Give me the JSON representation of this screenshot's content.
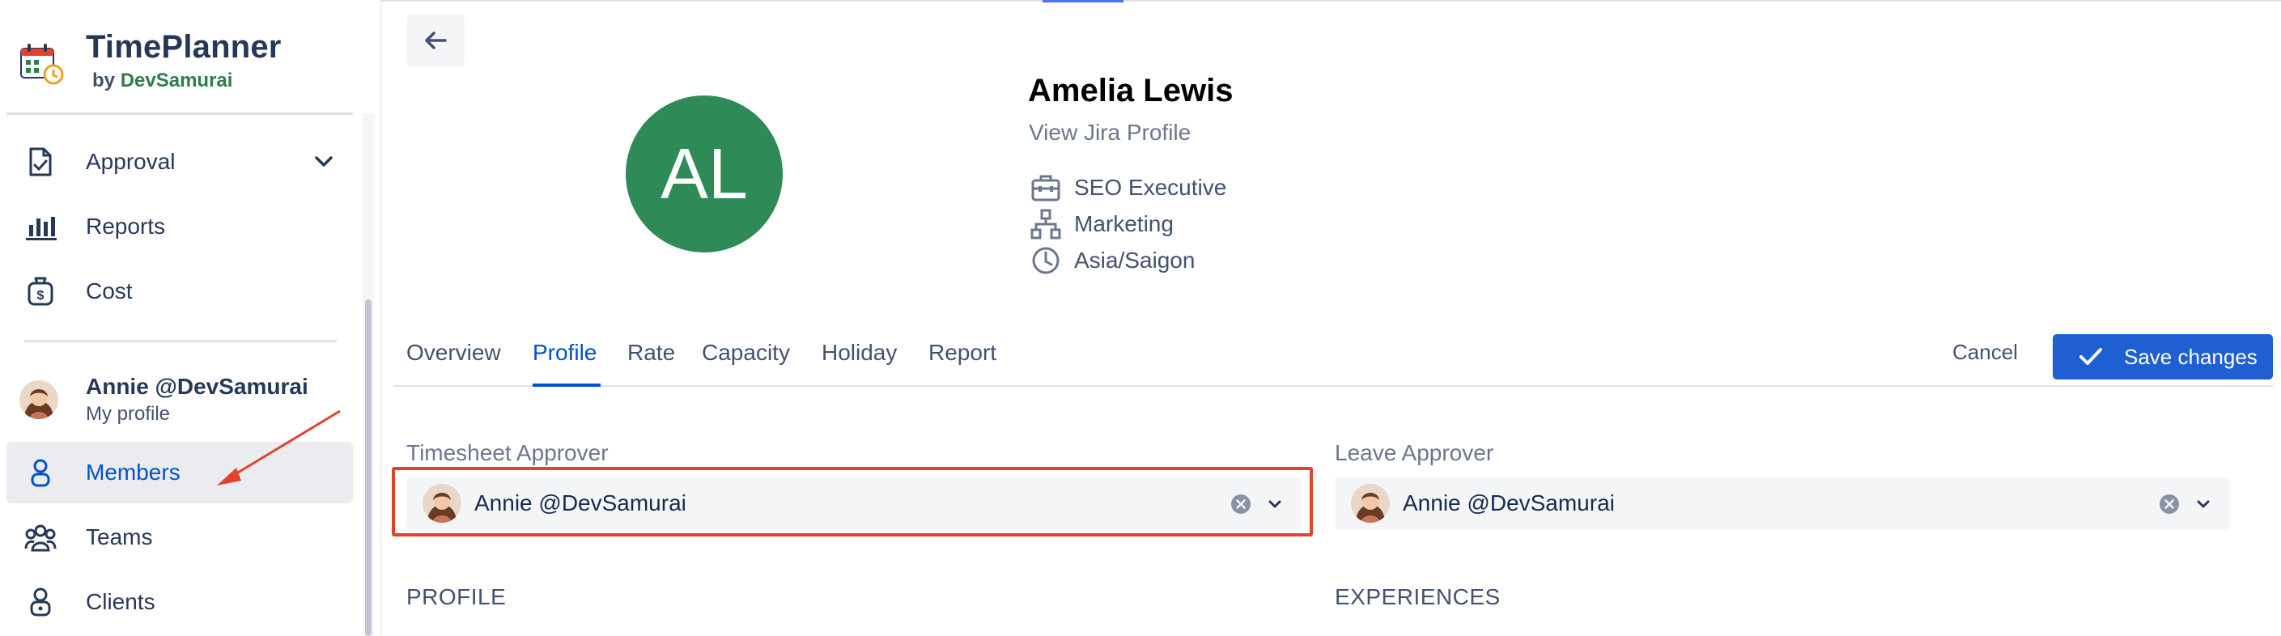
{
  "brand": {
    "title": "TimePlanner",
    "by": "by",
    "company": "DevSamurai"
  },
  "sidebar": {
    "items": [
      {
        "label": "Approval",
        "icon": "document-check-icon"
      },
      {
        "label": "Reports",
        "icon": "bar-chart-icon"
      },
      {
        "label": "Cost",
        "icon": "money-bag-icon"
      }
    ],
    "profile": {
      "name": "Annie @DevSamurai",
      "sub": "My profile"
    },
    "items2": [
      {
        "label": "Members",
        "icon": "person-icon",
        "active": true
      },
      {
        "label": "Teams",
        "icon": "team-icon"
      },
      {
        "label": "Clients",
        "icon": "lock-icon"
      }
    ]
  },
  "member": {
    "initials": "AL",
    "name": "Amelia Lewis",
    "jira_link": "View Jira Profile",
    "title": "SEO Executive",
    "department": "Marketing",
    "timezone": "Asia/Saigon",
    "avatar_color": "#2e8b57"
  },
  "tabs": [
    {
      "label": "Overview"
    },
    {
      "label": "Profile",
      "active": true
    },
    {
      "label": "Rate"
    },
    {
      "label": "Capacity"
    },
    {
      "label": "Holiday"
    },
    {
      "label": "Report"
    }
  ],
  "actions": {
    "cancel": "Cancel",
    "save": "Save changes"
  },
  "form": {
    "timesheet_label": "Timesheet Approver",
    "timesheet_value": "Annie @DevSamurai",
    "leave_label": "Leave Approver",
    "leave_value": "Annie @DevSamurai"
  },
  "sections": {
    "profile": "PROFILE",
    "experiences": "EXPERIENCES"
  },
  "colors": {
    "accent": "#0052cc",
    "save_button": "#1f5fd1",
    "highlight": "#e0442c"
  }
}
